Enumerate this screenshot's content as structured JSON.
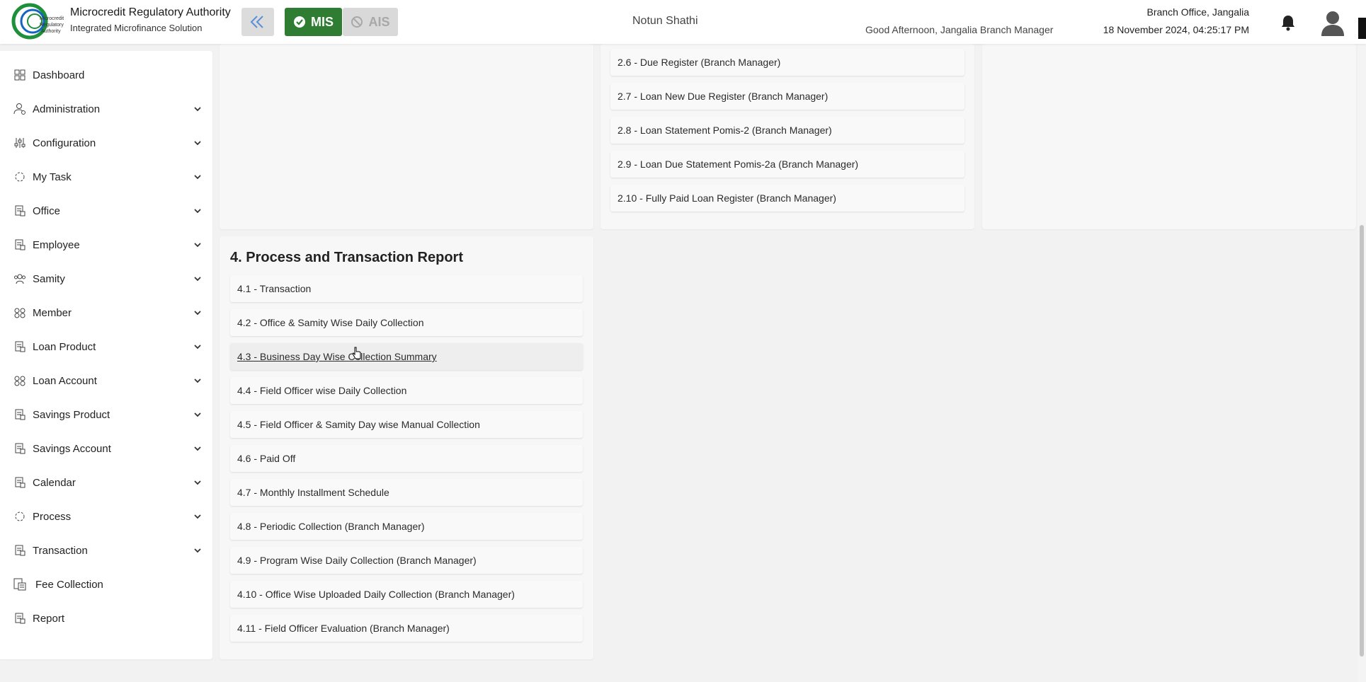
{
  "header": {
    "brand_title": "Microcredit Regulatory Authority",
    "brand_subtitle": "Integrated Microfinance Solution",
    "logo_text": "Microcredit Regulatory Authority",
    "mis_label": "MIS",
    "ais_label": "AIS",
    "org_name": "Notun Shathi",
    "greeting": "Good Afternoon, Jangalia Branch Manager",
    "branch_office": "Branch Office, Jangalia",
    "datetime": "18 November 2024, 04:25:17 PM",
    "icons": [
      "double-chevron-left-icon",
      "check-circle-icon",
      "ban-icon",
      "bell-icon",
      "user-avatar-icon"
    ]
  },
  "sidebar": {
    "items": [
      {
        "label": "Dashboard",
        "icon": "grid-icon",
        "expandable": false
      },
      {
        "label": "Administration",
        "icon": "user-cog-icon",
        "expandable": true
      },
      {
        "label": "Configuration",
        "icon": "sliders-icon",
        "expandable": true
      },
      {
        "label": "My Task",
        "icon": "dashed-circle-icon",
        "expandable": true
      },
      {
        "label": "Office",
        "icon": "document-icon",
        "expandable": true
      },
      {
        "label": "Employee",
        "icon": "document-icon",
        "expandable": true
      },
      {
        "label": "Samity",
        "icon": "group-icon",
        "expandable": true
      },
      {
        "label": "Member",
        "icon": "members-icon",
        "expandable": true
      },
      {
        "label": "Loan Product",
        "icon": "document-icon",
        "expandable": true
      },
      {
        "label": "Loan Account",
        "icon": "members-icon",
        "expandable": true
      },
      {
        "label": "Savings Product",
        "icon": "document-icon",
        "expandable": true
      },
      {
        "label": "Savings Account",
        "icon": "document-icon",
        "expandable": true
      },
      {
        "label": "Calendar",
        "icon": "document-icon",
        "expandable": true
      },
      {
        "label": "Process",
        "icon": "dashed-circle-icon",
        "expandable": true
      },
      {
        "label": "Transaction",
        "icon": "document-icon",
        "expandable": true
      },
      {
        "label": "Fee Collection",
        "icon": "fee-icon",
        "expandable": false
      },
      {
        "label": "Report",
        "icon": "document-icon",
        "expandable": false
      }
    ]
  },
  "loan_reports": {
    "items": [
      "2.6 - Due Register (Branch Manager)",
      "2.7 - Loan New Due Register (Branch Manager)",
      "2.8 - Loan Statement Pomis-2 (Branch Manager)",
      "2.9 - Loan Due Statement Pomis-2a (Branch Manager)",
      "2.10 - Fully Paid Loan Register (Branch Manager)"
    ]
  },
  "process_reports": {
    "title": "4. Process and Transaction Report",
    "items": [
      "4.1 - Transaction",
      "4.2 - Office & Samity Wise Daily Collection",
      "4.3 - Business Day Wise Collection Summary",
      "4.4 - Field Officer wise Daily Collection",
      "4.5 - Field Officer & Samity Day wise Manual Collection",
      "4.6 - Paid Off",
      "4.7 - Monthly Installment Schedule",
      "4.8 - Periodic Collection (Branch Manager)",
      "4.9 - Program Wise Daily Collection (Branch Manager)",
      "4.10 - Office Wise Uploaded Daily Collection (Branch Manager)",
      "4.11 - Field Officer Evaluation (Branch Manager)"
    ],
    "hovered_index": 2
  },
  "colors": {
    "mis_active": "#2e7d32",
    "ais_inactive": "#d9d9d9",
    "logo_green": "#1e8f3a",
    "logo_blue": "#1565c0"
  }
}
